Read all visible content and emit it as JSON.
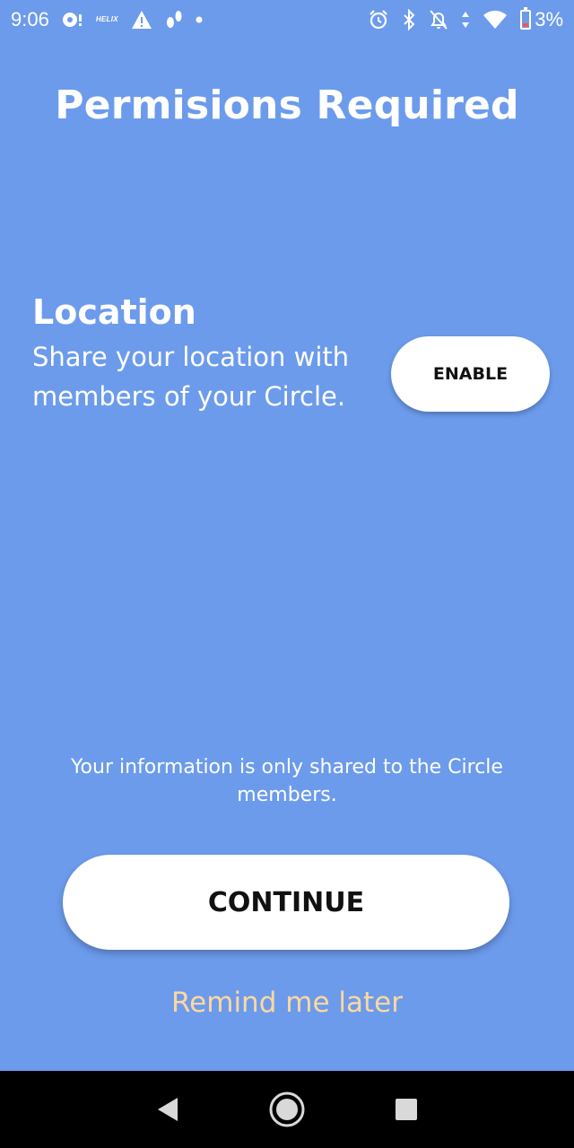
{
  "status_bar": {
    "time": "9:06",
    "helix_label": "HELIX",
    "battery_percent": "3%",
    "icons": [
      "notification-icon",
      "helix-app-icon",
      "warning-icon",
      "steps-icon",
      "dot-icon",
      "alarm-icon",
      "bluetooth-icon",
      "bell-off-icon",
      "data-arrows-icon",
      "wifi-icon",
      "battery-icon"
    ]
  },
  "page": {
    "title": "Permisions Required"
  },
  "permission": {
    "title": "Location",
    "description_line1": "Share your location with",
    "description_line2": "members of your Circle.",
    "enable_label": "ENABLE"
  },
  "info": {
    "line1": "Your information is only shared to the Circle",
    "line2": "members."
  },
  "actions": {
    "continue_label": "CONTINUE",
    "remind_label": "Remind me later"
  },
  "nav_bar": {
    "icons": [
      "back-icon",
      "home-icon",
      "recents-icon"
    ]
  },
  "colors": {
    "background": "#6C9BEC",
    "button_bg": "#FFFFFF",
    "remind_link": "#FFD89E",
    "nav_bar": "#000000"
  }
}
